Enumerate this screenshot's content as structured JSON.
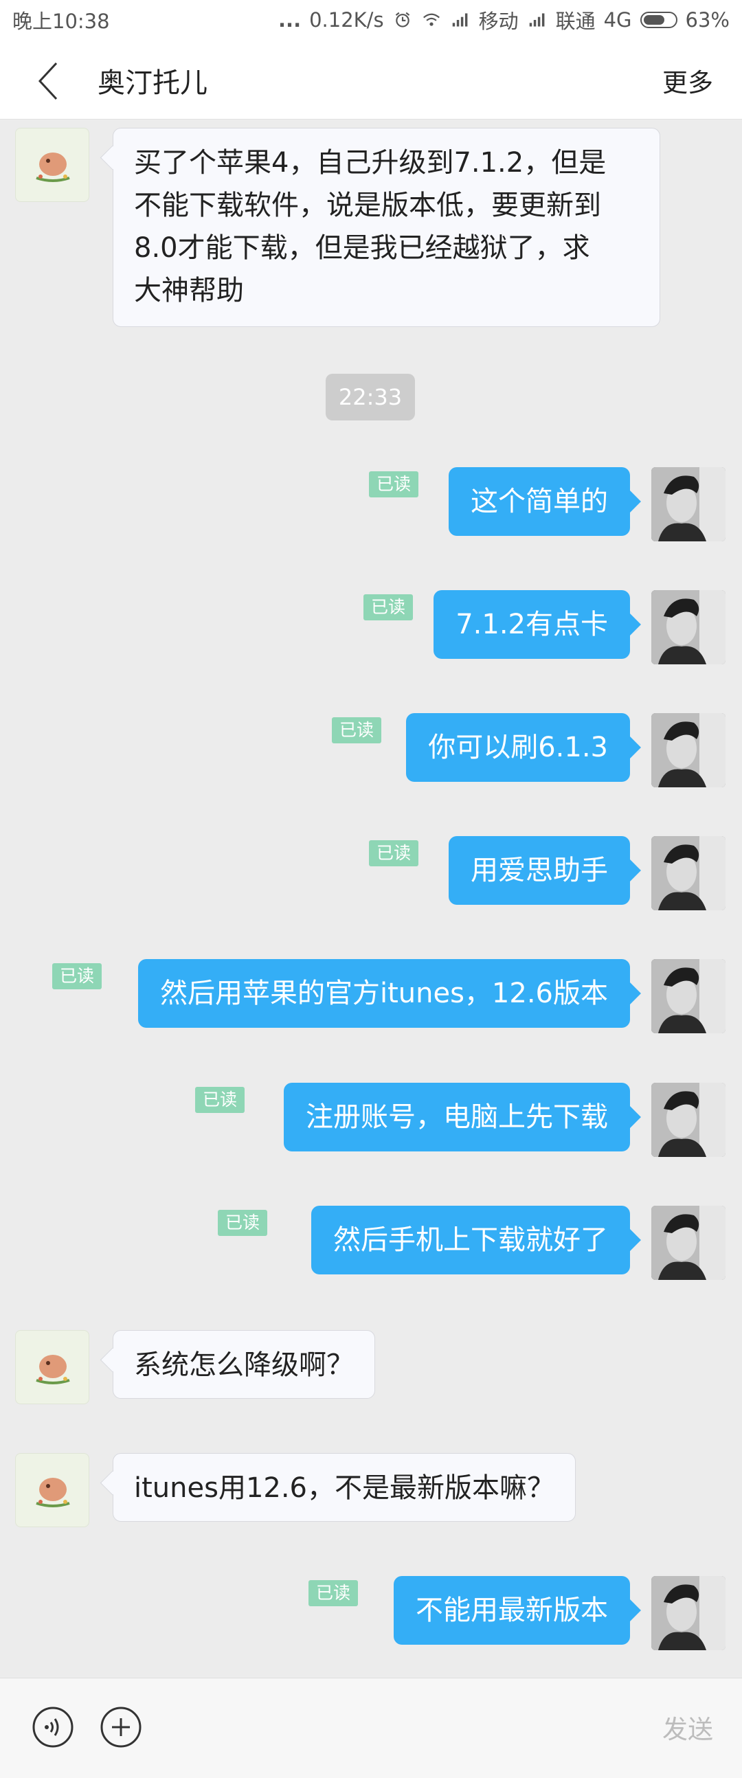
{
  "status_bar": {
    "time": "晚上10:38",
    "dots": "...",
    "net_speed": "0.12K/s",
    "carrier1": "移动",
    "carrier2": "联通",
    "network_type": "4G",
    "battery": "63%"
  },
  "nav": {
    "title": "奥汀托儿",
    "more_label": "更多"
  },
  "chat": {
    "timestamp": "22:33",
    "read_label": "已读",
    "messages": [
      {
        "side": "left",
        "lines": [
          "买了个苹果4，自己升级到7.1.2，但是",
          "不能下载软件，说是版本低，要更新到",
          "8.0才能下载，但是我已经越狱了，求",
          "大神帮助"
        ]
      },
      {
        "side": "right",
        "text": "这个简单的",
        "read": true
      },
      {
        "side": "right",
        "text": "7.1.2有点卡",
        "read": true
      },
      {
        "side": "right",
        "text": "你可以刷6.1.3",
        "read": true
      },
      {
        "side": "right",
        "text": "用爱思助手",
        "read": true
      },
      {
        "side": "right",
        "text": "然后用苹果的官方itunes，12.6版本",
        "read": true
      },
      {
        "side": "right",
        "text": "注册账号，电脑上先下载",
        "read": true
      },
      {
        "side": "right",
        "text": "然后手机上下载就好了",
        "read": true
      },
      {
        "side": "left",
        "text": "系统怎么降级啊？"
      },
      {
        "side": "left",
        "text": "itunes用12.6，不是最新版本嘛？"
      },
      {
        "side": "right",
        "text": "不能用最新版本",
        "read": true
      }
    ]
  },
  "input_bar": {
    "send_label": "发送",
    "voice_icon": "voice-icon",
    "plus_icon": "plus-icon"
  },
  "colors": {
    "bubble_right": "#34aef6",
    "read_badge": "#8ed6b5",
    "background": "#ececec"
  }
}
